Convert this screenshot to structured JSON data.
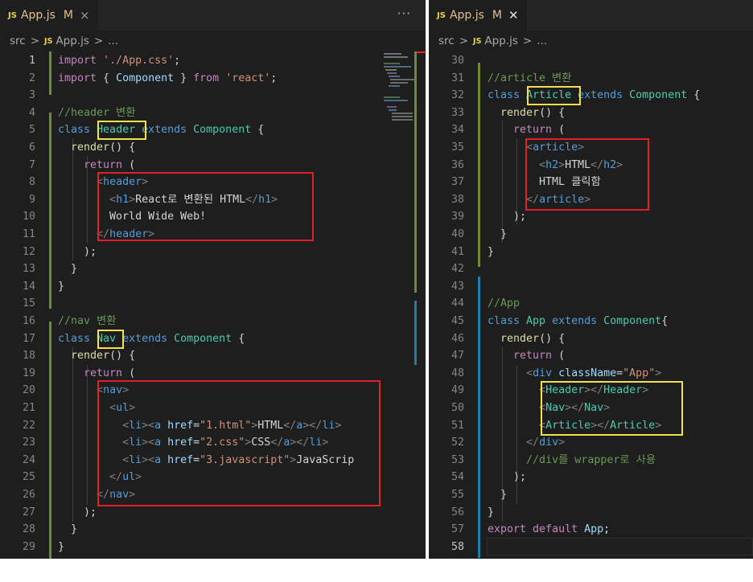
{
  "left": {
    "tab": {
      "badge": "JS",
      "name": "App.js",
      "modified": "M",
      "close": "×"
    },
    "more": "···",
    "breadcrumb": {
      "folder": "src",
      "sep": ">",
      "badge": "JS",
      "file": "App.js",
      "rest": "..."
    },
    "lines": [
      {
        "n": "1",
        "cur": true,
        "tokens": [
          {
            "t": "import ",
            "c": "kc"
          },
          {
            "t": "'./App.css'",
            "c": "str"
          },
          {
            "t": ";",
            "c": ""
          }
        ]
      },
      {
        "n": "2",
        "tokens": [
          {
            "t": "import ",
            "c": "kc"
          },
          {
            "t": "{ ",
            "c": ""
          },
          {
            "t": "Component",
            "c": "var"
          },
          {
            "t": " } ",
            "c": ""
          },
          {
            "t": "from ",
            "c": "kc"
          },
          {
            "t": "'react'",
            "c": "str"
          },
          {
            "t": ";",
            "c": ""
          }
        ]
      },
      {
        "n": "3",
        "tokens": []
      },
      {
        "n": "4",
        "tokens": [
          {
            "t": "//header 변환",
            "c": "com"
          }
        ]
      },
      {
        "n": "5",
        "tokens": [
          {
            "t": "class ",
            "c": "kw"
          },
          {
            "t": "Header",
            "c": "cls"
          },
          {
            "t": " ",
            "c": ""
          },
          {
            "t": "extends ",
            "c": "kw"
          },
          {
            "t": "Component",
            "c": "cls"
          },
          {
            "t": " {",
            "c": ""
          }
        ]
      },
      {
        "n": "6",
        "tokens": [
          {
            "t": "  ",
            "c": ""
          },
          {
            "t": "render",
            "c": "fn"
          },
          {
            "t": "() {",
            "c": ""
          }
        ]
      },
      {
        "n": "7",
        "tokens": [
          {
            "t": "    ",
            "c": ""
          },
          {
            "t": "return",
            "c": "kc"
          },
          {
            "t": " (",
            "c": ""
          }
        ]
      },
      {
        "n": "8",
        "tokens": [
          {
            "t": "      ",
            "c": ""
          },
          {
            "t": "<",
            "c": "br"
          },
          {
            "t": "header",
            "c": "tag"
          },
          {
            "t": ">",
            "c": "br"
          }
        ]
      },
      {
        "n": "9",
        "tokens": [
          {
            "t": "        ",
            "c": ""
          },
          {
            "t": "<",
            "c": "br"
          },
          {
            "t": "h1",
            "c": "tag"
          },
          {
            "t": ">",
            "c": "br"
          },
          {
            "t": "React로 변환된 HTML",
            "c": ""
          },
          {
            "t": "</",
            "c": "br"
          },
          {
            "t": "h1",
            "c": "tag"
          },
          {
            "t": ">",
            "c": "br"
          }
        ]
      },
      {
        "n": "10",
        "tokens": [
          {
            "t": "        World Wide Web!",
            "c": ""
          }
        ]
      },
      {
        "n": "11",
        "tokens": [
          {
            "t": "      ",
            "c": ""
          },
          {
            "t": "</",
            "c": "br"
          },
          {
            "t": "header",
            "c": "tag"
          },
          {
            "t": ">",
            "c": "br"
          }
        ]
      },
      {
        "n": "12",
        "tokens": [
          {
            "t": "    );",
            "c": ""
          }
        ]
      },
      {
        "n": "13",
        "tokens": [
          {
            "t": "  }",
            "c": ""
          }
        ]
      },
      {
        "n": "14",
        "tokens": [
          {
            "t": "}",
            "c": ""
          }
        ]
      },
      {
        "n": "15",
        "tokens": []
      },
      {
        "n": "16",
        "tokens": [
          {
            "t": "//nav 변환",
            "c": "com"
          }
        ]
      },
      {
        "n": "17",
        "tokens": [
          {
            "t": "class ",
            "c": "kw"
          },
          {
            "t": "Nav",
            "c": "cls"
          },
          {
            "t": " ",
            "c": ""
          },
          {
            "t": "extends ",
            "c": "kw"
          },
          {
            "t": "Component",
            "c": "cls"
          },
          {
            "t": " {",
            "c": ""
          }
        ]
      },
      {
        "n": "18",
        "tokens": [
          {
            "t": "  ",
            "c": ""
          },
          {
            "t": "render",
            "c": "fn"
          },
          {
            "t": "() {",
            "c": ""
          }
        ]
      },
      {
        "n": "19",
        "tokens": [
          {
            "t": "    ",
            "c": ""
          },
          {
            "t": "return",
            "c": "kc"
          },
          {
            "t": " (",
            "c": ""
          }
        ]
      },
      {
        "n": "20",
        "tokens": [
          {
            "t": "      ",
            "c": ""
          },
          {
            "t": "<",
            "c": "br"
          },
          {
            "t": "nav",
            "c": "tag"
          },
          {
            "t": ">",
            "c": "br"
          }
        ]
      },
      {
        "n": "21",
        "tokens": [
          {
            "t": "        ",
            "c": ""
          },
          {
            "t": "<",
            "c": "br"
          },
          {
            "t": "ul",
            "c": "tag"
          },
          {
            "t": ">",
            "c": "br"
          }
        ]
      },
      {
        "n": "22",
        "tokens": [
          {
            "t": "          ",
            "c": ""
          },
          {
            "t": "<",
            "c": "br"
          },
          {
            "t": "li",
            "c": "tag"
          },
          {
            "t": "><",
            "c": "br"
          },
          {
            "t": "a",
            "c": "tag"
          },
          {
            "t": " href",
            "c": "at"
          },
          {
            "t": "=",
            "c": ""
          },
          {
            "t": "\"1.html\"",
            "c": "str"
          },
          {
            "t": ">",
            "c": "br"
          },
          {
            "t": "HTML",
            "c": ""
          },
          {
            "t": "</",
            "c": "br"
          },
          {
            "t": "a",
            "c": "tag"
          },
          {
            "t": "></",
            "c": "br"
          },
          {
            "t": "li",
            "c": "tag"
          },
          {
            "t": ">",
            "c": "br"
          }
        ]
      },
      {
        "n": "23",
        "tokens": [
          {
            "t": "          ",
            "c": ""
          },
          {
            "t": "<",
            "c": "br"
          },
          {
            "t": "li",
            "c": "tag"
          },
          {
            "t": "><",
            "c": "br"
          },
          {
            "t": "a",
            "c": "tag"
          },
          {
            "t": " href",
            "c": "at"
          },
          {
            "t": "=",
            "c": ""
          },
          {
            "t": "\"2.css\"",
            "c": "str"
          },
          {
            "t": ">",
            "c": "br"
          },
          {
            "t": "CSS",
            "c": ""
          },
          {
            "t": "</",
            "c": "br"
          },
          {
            "t": "a",
            "c": "tag"
          },
          {
            "t": "></",
            "c": "br"
          },
          {
            "t": "li",
            "c": "tag"
          },
          {
            "t": ">",
            "c": "br"
          }
        ]
      },
      {
        "n": "24",
        "tokens": [
          {
            "t": "          ",
            "c": ""
          },
          {
            "t": "<",
            "c": "br"
          },
          {
            "t": "li",
            "c": "tag"
          },
          {
            "t": "><",
            "c": "br"
          },
          {
            "t": "a",
            "c": "tag"
          },
          {
            "t": " href",
            "c": "at"
          },
          {
            "t": "=",
            "c": ""
          },
          {
            "t": "\"3.javascript\"",
            "c": "str"
          },
          {
            "t": ">",
            "c": "br"
          },
          {
            "t": "JavaScrip",
            "c": ""
          }
        ]
      },
      {
        "n": "25",
        "tokens": [
          {
            "t": "        ",
            "c": ""
          },
          {
            "t": "</",
            "c": "br"
          },
          {
            "t": "ul",
            "c": "tag"
          },
          {
            "t": ">",
            "c": "br"
          }
        ]
      },
      {
        "n": "26",
        "tokens": [
          {
            "t": "      ",
            "c": ""
          },
          {
            "t": "</",
            "c": "br"
          },
          {
            "t": "nav",
            "c": "tag"
          },
          {
            "t": ">",
            "c": "br"
          }
        ]
      },
      {
        "n": "27",
        "tokens": [
          {
            "t": "    );",
            "c": ""
          }
        ]
      },
      {
        "n": "28",
        "tokens": [
          {
            "t": "  }",
            "c": ""
          }
        ]
      },
      {
        "n": "29",
        "tokens": [
          {
            "t": "}",
            "c": ""
          }
        ]
      }
    ]
  },
  "right": {
    "tab": {
      "badge": "JS",
      "name": "App.js",
      "modified": "M",
      "close": "✕"
    },
    "breadcrumb": {
      "folder": "src",
      "sep": ">",
      "badge": "JS",
      "file": "App.js",
      "rest": "..."
    },
    "lines": [
      {
        "n": "30",
        "tokens": []
      },
      {
        "n": "31",
        "tokens": [
          {
            "t": "//article 변환",
            "c": "com"
          }
        ]
      },
      {
        "n": "32",
        "tokens": [
          {
            "t": "class ",
            "c": "kw"
          },
          {
            "t": "Article",
            "c": "cls"
          },
          {
            "t": " ",
            "c": ""
          },
          {
            "t": "extends ",
            "c": "kw"
          },
          {
            "t": "Component",
            "c": "cls"
          },
          {
            "t": " {",
            "c": ""
          }
        ]
      },
      {
        "n": "33",
        "tokens": [
          {
            "t": "  ",
            "c": ""
          },
          {
            "t": "render",
            "c": "fn"
          },
          {
            "t": "() {",
            "c": ""
          }
        ]
      },
      {
        "n": "34",
        "tokens": [
          {
            "t": "    ",
            "c": ""
          },
          {
            "t": "return",
            "c": "kc"
          },
          {
            "t": " (",
            "c": ""
          }
        ]
      },
      {
        "n": "35",
        "tokens": [
          {
            "t": "      ",
            "c": ""
          },
          {
            "t": "<",
            "c": "br"
          },
          {
            "t": "article",
            "c": "tag"
          },
          {
            "t": ">",
            "c": "br"
          }
        ]
      },
      {
        "n": "36",
        "tokens": [
          {
            "t": "        ",
            "c": ""
          },
          {
            "t": "<",
            "c": "br"
          },
          {
            "t": "h2",
            "c": "tag"
          },
          {
            "t": ">",
            "c": "br"
          },
          {
            "t": "HTML",
            "c": ""
          },
          {
            "t": "</",
            "c": "br"
          },
          {
            "t": "h2",
            "c": "tag"
          },
          {
            "t": ">",
            "c": "br"
          }
        ]
      },
      {
        "n": "37",
        "tokens": [
          {
            "t": "        HTML 클릭함",
            "c": ""
          }
        ]
      },
      {
        "n": "38",
        "tokens": [
          {
            "t": "      ",
            "c": ""
          },
          {
            "t": "</",
            "c": "br"
          },
          {
            "t": "article",
            "c": "tag"
          },
          {
            "t": ">",
            "c": "br"
          }
        ]
      },
      {
        "n": "39",
        "tokens": [
          {
            "t": "    );",
            "c": ""
          }
        ]
      },
      {
        "n": "40",
        "tokens": [
          {
            "t": "  }",
            "c": ""
          }
        ]
      },
      {
        "n": "41",
        "tokens": [
          {
            "t": "}",
            "c": ""
          }
        ]
      },
      {
        "n": "42",
        "tokens": []
      },
      {
        "n": "43",
        "tokens": []
      },
      {
        "n": "44",
        "tokens": [
          {
            "t": "//App",
            "c": "com"
          }
        ]
      },
      {
        "n": "45",
        "tokens": [
          {
            "t": "class ",
            "c": "kw"
          },
          {
            "t": "App",
            "c": "cls"
          },
          {
            "t": " ",
            "c": ""
          },
          {
            "t": "extends ",
            "c": "kw"
          },
          {
            "t": "Component",
            "c": "cls"
          },
          {
            "t": "{",
            "c": ""
          }
        ]
      },
      {
        "n": "46",
        "tokens": [
          {
            "t": "  ",
            "c": ""
          },
          {
            "t": "render",
            "c": "fn"
          },
          {
            "t": "() {",
            "c": ""
          }
        ]
      },
      {
        "n": "47",
        "tokens": [
          {
            "t": "    ",
            "c": ""
          },
          {
            "t": "return",
            "c": "kc"
          },
          {
            "t": " (",
            "c": ""
          }
        ]
      },
      {
        "n": "48",
        "tokens": [
          {
            "t": "      ",
            "c": ""
          },
          {
            "t": "<",
            "c": "br"
          },
          {
            "t": "div",
            "c": "tag"
          },
          {
            "t": " className",
            "c": "at"
          },
          {
            "t": "=",
            "c": ""
          },
          {
            "t": "\"App\"",
            "c": "str"
          },
          {
            "t": ">",
            "c": "br"
          }
        ]
      },
      {
        "n": "49",
        "tokens": [
          {
            "t": "        ",
            "c": ""
          },
          {
            "t": "<",
            "c": "br"
          },
          {
            "t": "Header",
            "c": "cls"
          },
          {
            "t": "></",
            "c": "br"
          },
          {
            "t": "Header",
            "c": "cls"
          },
          {
            "t": ">",
            "c": "br"
          }
        ]
      },
      {
        "n": "50",
        "tokens": [
          {
            "t": "        ",
            "c": ""
          },
          {
            "t": "<",
            "c": "br"
          },
          {
            "t": "Nav",
            "c": "cls"
          },
          {
            "t": "></",
            "c": "br"
          },
          {
            "t": "Nav",
            "c": "cls"
          },
          {
            "t": ">",
            "c": "br"
          }
        ]
      },
      {
        "n": "51",
        "tokens": [
          {
            "t": "        ",
            "c": ""
          },
          {
            "t": "<",
            "c": "br"
          },
          {
            "t": "Article",
            "c": "cls"
          },
          {
            "t": "></",
            "c": "br"
          },
          {
            "t": "Article",
            "c": "cls"
          },
          {
            "t": ">",
            "c": "br"
          }
        ]
      },
      {
        "n": "52",
        "tokens": [
          {
            "t": "      ",
            "c": ""
          },
          {
            "t": "</",
            "c": "br"
          },
          {
            "t": "div",
            "c": "tag"
          },
          {
            "t": ">",
            "c": "br"
          }
        ]
      },
      {
        "n": "53",
        "tokens": [
          {
            "t": "      ",
            "c": ""
          },
          {
            "t": "//div를 wrapper로 사용",
            "c": "com"
          }
        ]
      },
      {
        "n": "54",
        "tokens": [
          {
            "t": "    );",
            "c": ""
          }
        ]
      },
      {
        "n": "55",
        "tokens": [
          {
            "t": "  }",
            "c": ""
          }
        ]
      },
      {
        "n": "56",
        "tokens": [
          {
            "t": "}",
            "c": ""
          }
        ]
      },
      {
        "n": "57",
        "tokens": [
          {
            "t": "export ",
            "c": "kc"
          },
          {
            "t": "default ",
            "c": "kc"
          },
          {
            "t": "App",
            "c": "var"
          },
          {
            "t": ";",
            "c": ""
          }
        ]
      },
      {
        "n": "58",
        "cur": true,
        "tokens": []
      }
    ]
  },
  "colors": {
    "highlight_yellow": "#f5e14a",
    "highlight_red": "#e0202a",
    "gutter_modified": "#6c8c3a",
    "gutter_added": "#1b81a8"
  }
}
